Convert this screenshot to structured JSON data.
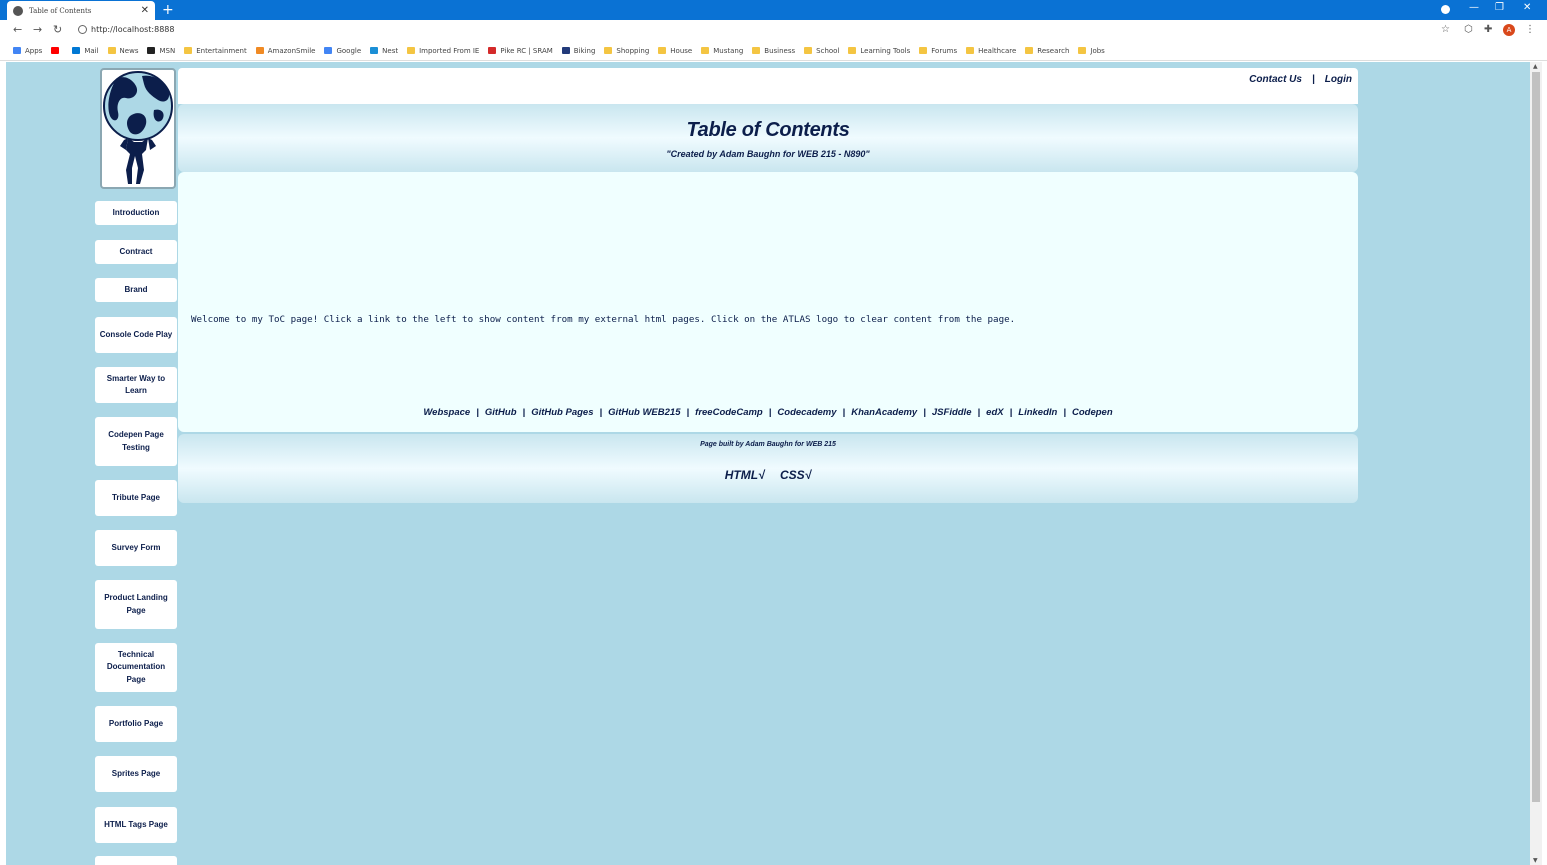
{
  "browser": {
    "tab_title": "Table of Contents",
    "tab_close": "✕",
    "new_tab": "+",
    "url": "http://localhost:8888",
    "win_min": "—",
    "win_max": "❐",
    "win_close": "✕",
    "avatar_initial": "A",
    "bookmarks": [
      {
        "label": "Apps",
        "color": "#4285f4"
      },
      {
        "label": "",
        "color": "#ff0000"
      },
      {
        "label": "Mail",
        "color": "#0078d4"
      },
      {
        "label": "News",
        "color": "#f4c542"
      },
      {
        "label": "MSN",
        "color": "#222222"
      },
      {
        "label": "Entertainment",
        "color": "#f4c542"
      },
      {
        "label": "AmazonSmile",
        "color": "#f08a24"
      },
      {
        "label": "Google",
        "color": "#4285f4"
      },
      {
        "label": "Nest",
        "color": "#1b8fd6"
      },
      {
        "label": "Imported From IE",
        "color": "#f4c542"
      },
      {
        "label": "Pike RC | SRAM",
        "color": "#d42a2a"
      },
      {
        "label": "Biking",
        "color": "#223a7a"
      },
      {
        "label": "Shopping",
        "color": "#f4c542"
      },
      {
        "label": "House",
        "color": "#f4c542"
      },
      {
        "label": "Mustang",
        "color": "#f4c542"
      },
      {
        "label": "Business",
        "color": "#f4c542"
      },
      {
        "label": "School",
        "color": "#f4c542"
      },
      {
        "label": "Learning Tools",
        "color": "#f4c542"
      },
      {
        "label": "Forums",
        "color": "#f4c542"
      },
      {
        "label": "Healthcare",
        "color": "#f4c542"
      },
      {
        "label": "Research",
        "color": "#f4c542"
      },
      {
        "label": "Jobs",
        "color": "#f4c542"
      }
    ]
  },
  "header": {
    "contact": "Contact Us",
    "separator": "|",
    "login": "Login",
    "title": "Table of Contents",
    "subtitle": "\"Created by Adam Baughn for WEB 215 - N890\""
  },
  "sidebar": {
    "items": [
      {
        "label": "Introduction"
      },
      {
        "label": "Contract"
      },
      {
        "label": "Brand"
      },
      {
        "label": "Console Code Play"
      },
      {
        "label": "Smarter Way to Learn"
      },
      {
        "label": "Codepen Page Testing"
      },
      {
        "label": "Tribute Page"
      },
      {
        "label": "Survey Form"
      },
      {
        "label": "Product Landing Page"
      },
      {
        "label": "Technical Documentation Page"
      },
      {
        "label": "Portfolio Page"
      },
      {
        "label": "Sprites Page"
      },
      {
        "label": "HTML Tags Page"
      }
    ]
  },
  "content": {
    "welcome": "Welcome to my ToC page! Click a link to the left to show content from my external html pages. Click on the ATLAS logo to clear content from the page."
  },
  "links": {
    "items": [
      "Webspace",
      "GitHub",
      "GitHub Pages",
      "GitHub WEB215",
      "freeCodeCamp",
      "Codecademy",
      "KhanAcademy",
      "JSFiddle",
      "edX",
      "LinkedIn",
      "Codepen"
    ],
    "separator": "|"
  },
  "footer": {
    "built": "Page built by Adam Baughn for WEB 215",
    "html_badge": "HTML√",
    "css_badge": "CSS√"
  },
  "colors": {
    "page_bg": "#add8e6",
    "text_navy": "#0c1e4b",
    "content_bg": "#f0ffff",
    "chrome_blue": "#0a72d4"
  }
}
